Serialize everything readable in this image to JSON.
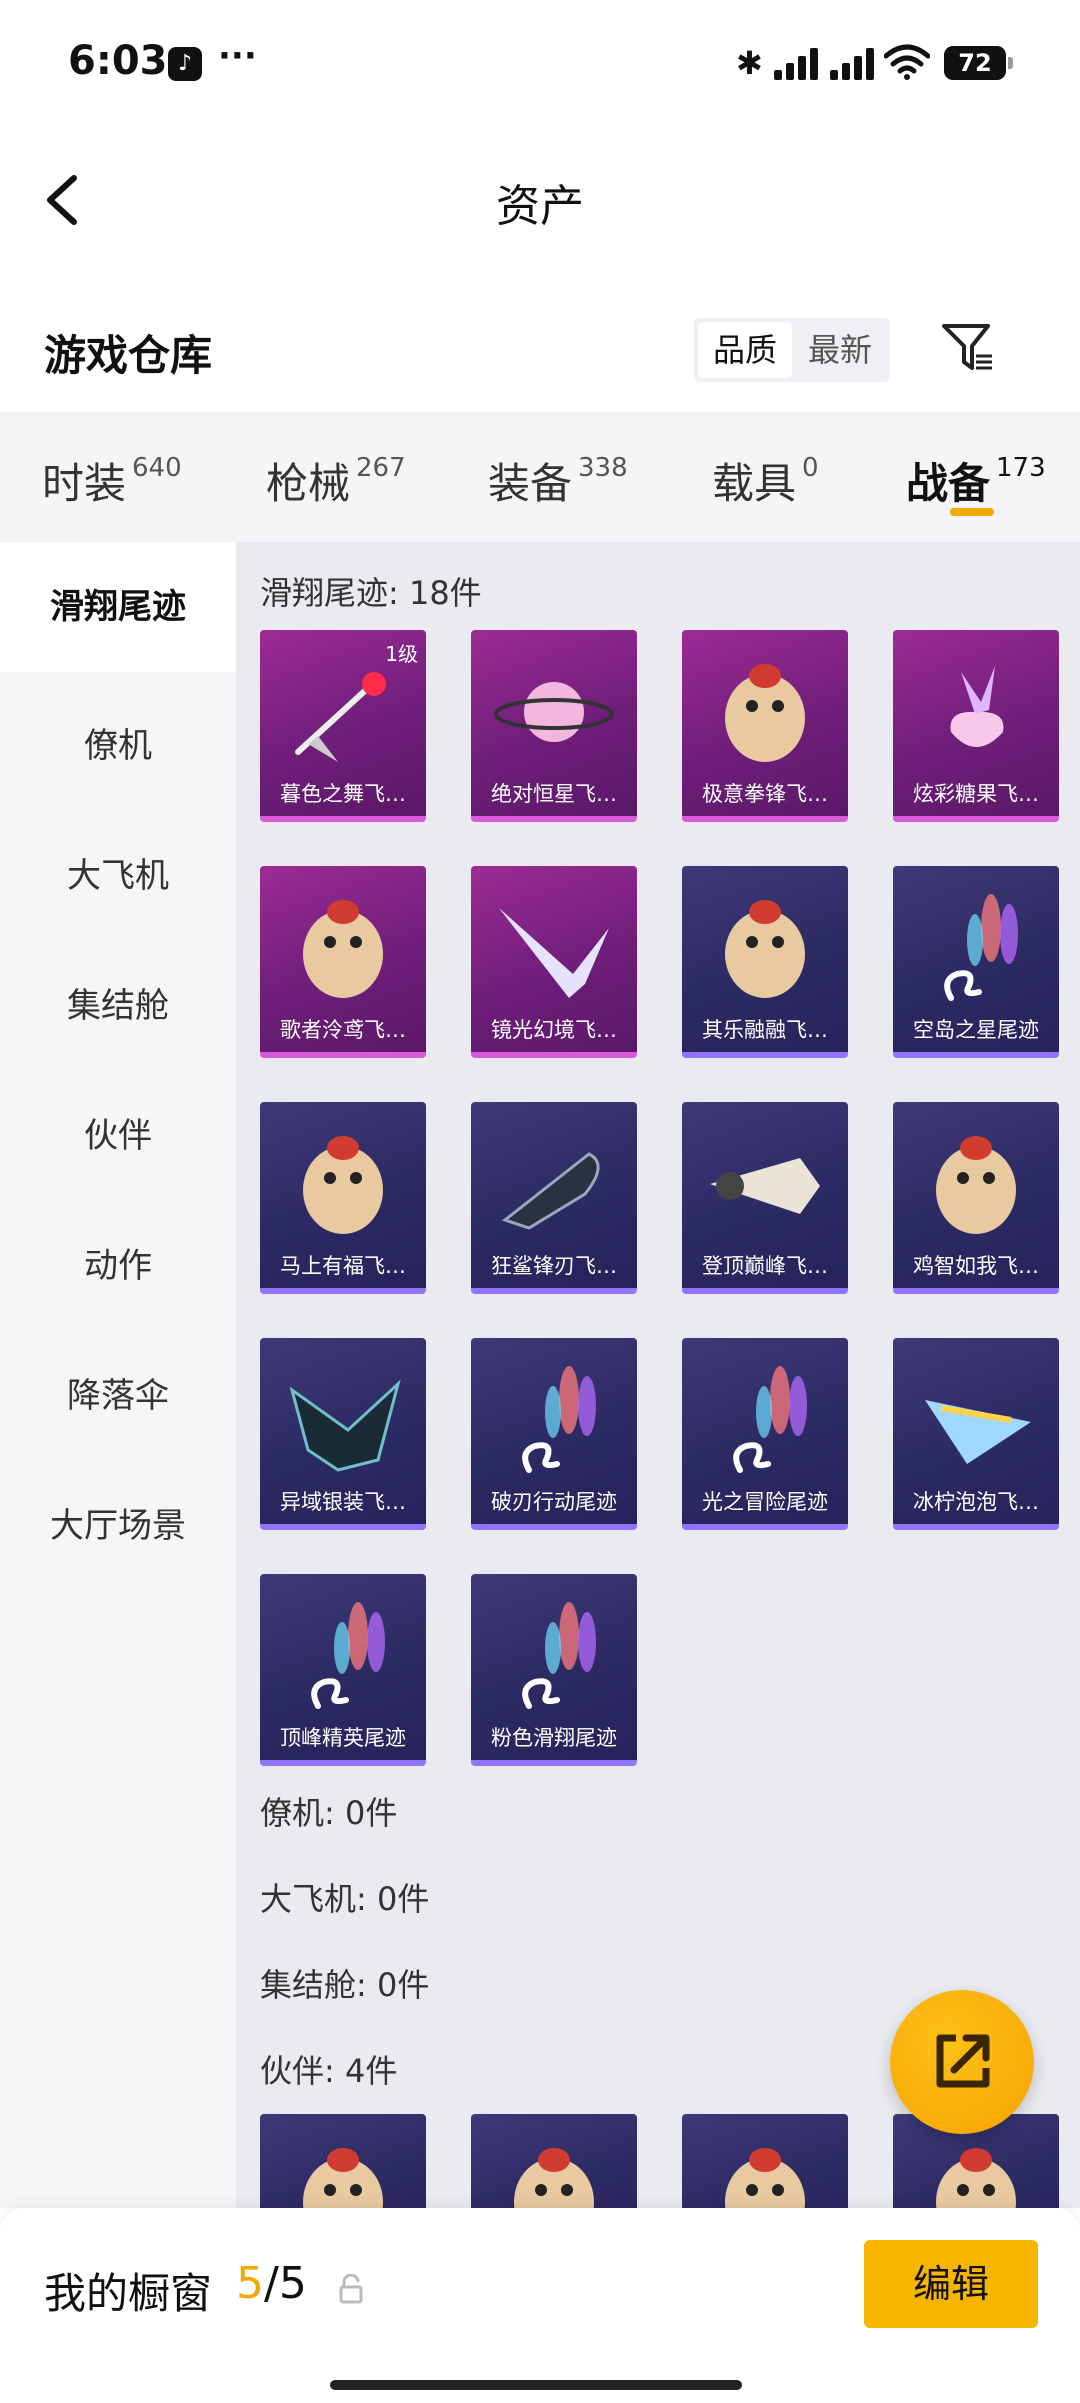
{
  "status": {
    "time": "6:03",
    "battery": "72"
  },
  "header": {
    "title": "资产"
  },
  "subheader": {
    "title": "游戏仓库",
    "sort_quality": "品质",
    "sort_newest": "最新"
  },
  "tabs": [
    {
      "label": "时装",
      "count": "640"
    },
    {
      "label": "枪械",
      "count": "267"
    },
    {
      "label": "装备",
      "count": "338"
    },
    {
      "label": "载具",
      "count": "0"
    },
    {
      "label": "战备",
      "count": "173"
    }
  ],
  "sidebar": [
    "滑翔尾迹",
    "僚机",
    "大飞机",
    "集结舱",
    "伙伴",
    "动作",
    "降落伞",
    "大厅场景"
  ],
  "sections": {
    "glide": "滑翔尾迹: 18件",
    "wingman": "僚机: 0件",
    "plane": "大飞机: 0件",
    "pod": "集结舱: 0件",
    "partner": "伙伴: 4件"
  },
  "items": [
    {
      "name": "暮色之舞飞…",
      "rarity": "purple",
      "badge": "1级",
      "icon": "dagger-trail-icon"
    },
    {
      "name": "绝对恒星飞…",
      "rarity": "purple",
      "icon": "planet-icon"
    },
    {
      "name": "极意拳锋飞…",
      "rarity": "purple",
      "icon": "elephant-icon"
    },
    {
      "name": "炫彩糖果飞…",
      "rarity": "purple",
      "icon": "candy-icon"
    },
    {
      "name": "歌者泠鸢飞…",
      "rarity": "purple",
      "icon": "bird-icon"
    },
    {
      "name": "镜光幻境飞…",
      "rarity": "purple",
      "icon": "wings-icon"
    },
    {
      "name": "其乐融融飞…",
      "rarity": "blue",
      "icon": "penguin-icon"
    },
    {
      "name": "空岛之星尾迹",
      "rarity": "blue",
      "icon": "smoke-trail-icon"
    },
    {
      "name": "马上有福飞…",
      "rarity": "blue",
      "icon": "horse-icon"
    },
    {
      "name": "狂鲨锋刃飞…",
      "rarity": "blue",
      "icon": "shark-icon"
    },
    {
      "name": "登顶巅峰飞…",
      "rarity": "blue",
      "icon": "jet-icon"
    },
    {
      "name": "鸡智如我飞…",
      "rarity": "blue",
      "icon": "chicken-icon"
    },
    {
      "name": "异域银装飞…",
      "rarity": "blue",
      "icon": "dark-wing-icon"
    },
    {
      "name": "破刃行动尾迹",
      "rarity": "blue",
      "icon": "smoke-trail-icon"
    },
    {
      "name": "光之冒险尾迹",
      "rarity": "blue",
      "icon": "smoke-trail-icon"
    },
    {
      "name": "冰柠泡泡飞…",
      "rarity": "blue",
      "icon": "glider-icon"
    },
    {
      "name": "顶峰精英尾迹",
      "rarity": "blue",
      "icon": "smoke-trail-icon"
    },
    {
      "name": "粉色滑翔尾迹",
      "rarity": "blue",
      "icon": "smoke-trail-icon"
    }
  ],
  "partners": [
    {
      "icon": "chef-partner-icon"
    },
    {
      "icon": "chicken-partner-icon"
    },
    {
      "icon": "pink-partner-icon"
    },
    {
      "icon": "helmet-partner-icon"
    }
  ],
  "bottom": {
    "label": "我的橱窗",
    "count_current": "5",
    "count_total": "/5",
    "edit": "编辑"
  },
  "colors": {
    "accent": "#f6a800",
    "purple_card": "#8a2488",
    "blue_card": "#2f2c6a"
  }
}
